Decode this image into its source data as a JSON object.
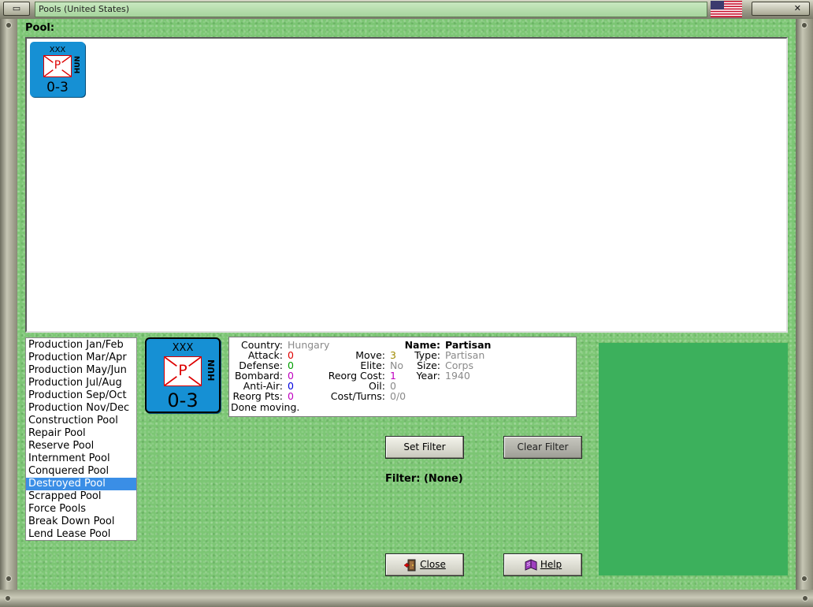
{
  "window": {
    "title": "Pools (United States)",
    "minimize_glyph": "▭",
    "close_glyph": "✕",
    "flag_icon": "us-flag-icon"
  },
  "pool": {
    "label": "Pool:",
    "units": [
      {
        "size": "XXX",
        "symbol": "P",
        "nationality": "HUN",
        "stats": "0-3"
      }
    ]
  },
  "pool_list": {
    "items": [
      "Production Jan/Feb",
      "Production Mar/Apr",
      "Production May/Jun",
      "Production Jul/Aug",
      "Production Sep/Oct",
      "Production Nov/Dec",
      "Construction Pool",
      "Repair Pool",
      "Reserve Pool",
      "Internment Pool",
      "Conquered Pool",
      "Destroyed Pool",
      "Scrapped Pool",
      "Force Pools",
      "Break Down Pool",
      "Lend Lease Pool"
    ],
    "selected": "Destroyed Pool"
  },
  "selected_unit": {
    "size": "XXX",
    "symbol": "P",
    "nationality": "HUN",
    "stats": "0-3"
  },
  "info": {
    "country_label": "Country:",
    "country": "Hungary",
    "attack_label": "Attack:",
    "attack": "0",
    "defense_label": "Defense:",
    "defense": "0",
    "bombard_label": "Bombard:",
    "bombard": "0",
    "antiair_label": "Anti-Air:",
    "antiair": "0",
    "reorg_pts_label": "Reorg Pts:",
    "reorg_pts": "0",
    "status": "Done moving.",
    "move_label": "Move:",
    "move": "3",
    "elite_label": "Elite:",
    "elite": "No",
    "reorg_cost_label": "Reorg Cost:",
    "reorg_cost": "1",
    "oil_label": "Oil:",
    "oil": "0",
    "cost_turns_label": "Cost/Turns:",
    "cost_turns": "0/0",
    "name_label": "Name:",
    "name": "Partisan",
    "type_label": "Type:",
    "type": "Partisan",
    "unit_size_label": "Size:",
    "unit_size": "Corps",
    "year_label": "Year:",
    "year": "1940"
  },
  "buttons": {
    "set_filter": "Set Filter",
    "clear_filter": "Clear Filter",
    "close": "Close",
    "help": "Help"
  },
  "filter": {
    "text": "Filter: (None)"
  },
  "colors": {
    "counter_blue": "#1690d4",
    "selection_blue": "#3a8ee6",
    "panel_green": "#3cb05c",
    "felt_green": "#7cc674"
  }
}
